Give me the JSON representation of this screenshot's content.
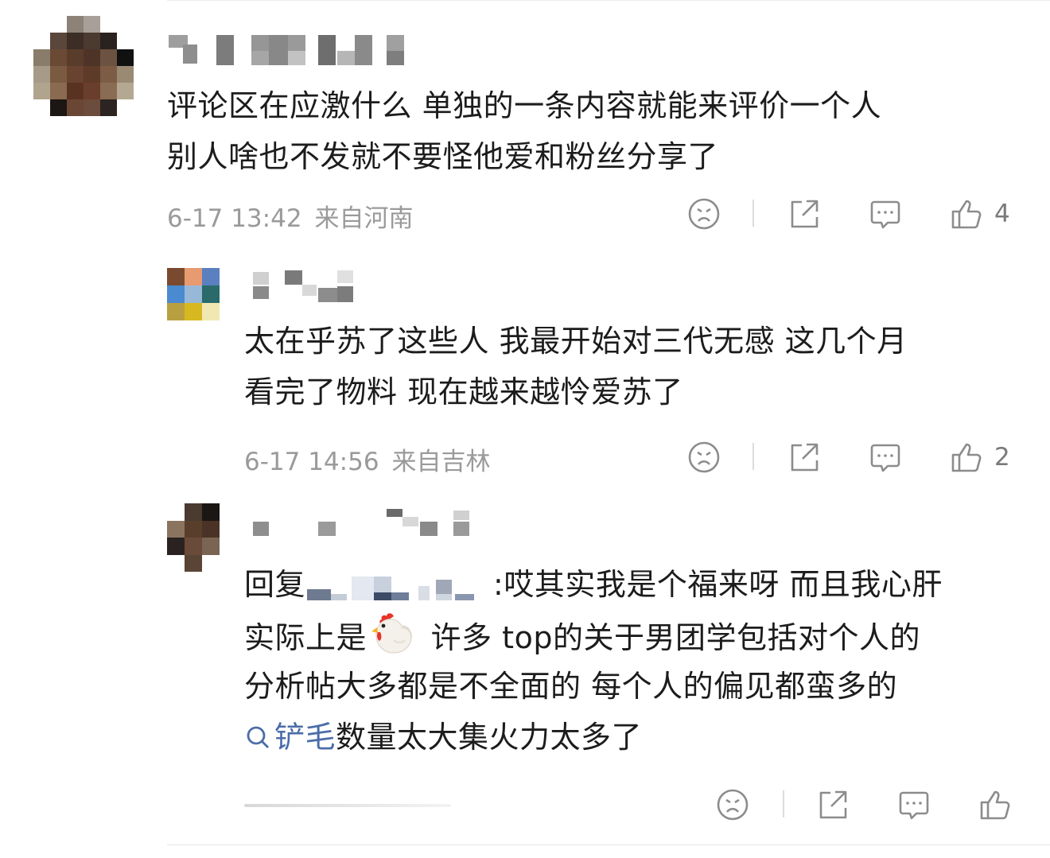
{
  "comments": [
    {
      "id": "main",
      "lines": [
        "评论区在应激什么 单独的一条内容就能来评价一个人",
        "别人啥也不发就不要怪他爱和粉丝分享了"
      ],
      "date": "6-17 13:42",
      "location": "来自河南",
      "likes": "4"
    },
    {
      "id": "reply1",
      "lines": [
        "太在乎苏了这些人 我最开始对三代无感 这几个月",
        "看完了物料 现在越来越怜爱苏了"
      ],
      "date": "6-17 14:56",
      "location": "来自吉林",
      "likes": "2"
    },
    {
      "id": "reply2",
      "reply_prefix": "回复",
      "line1_rest": ":哎其实我是个福来呀 而且我心肝",
      "line2_before": "实际上是",
      "line2_after": " 许多 top的关于男团学包括对个人的",
      "line3": "分析帖大多都是不全面的 每个人的偏见都蛮多的",
      "search_link": "铲毛",
      "line4_rest": "数量太大集火力太多了"
    }
  ],
  "icons": [
    "sad-face-icon",
    "share-icon",
    "comment-icon",
    "thumbs-up-icon",
    "search-icon",
    "rooster-emoji"
  ],
  "colors": {
    "meta": "#9a9a9a",
    "link": "#4a6da8",
    "icon": "#8c8c8c"
  }
}
